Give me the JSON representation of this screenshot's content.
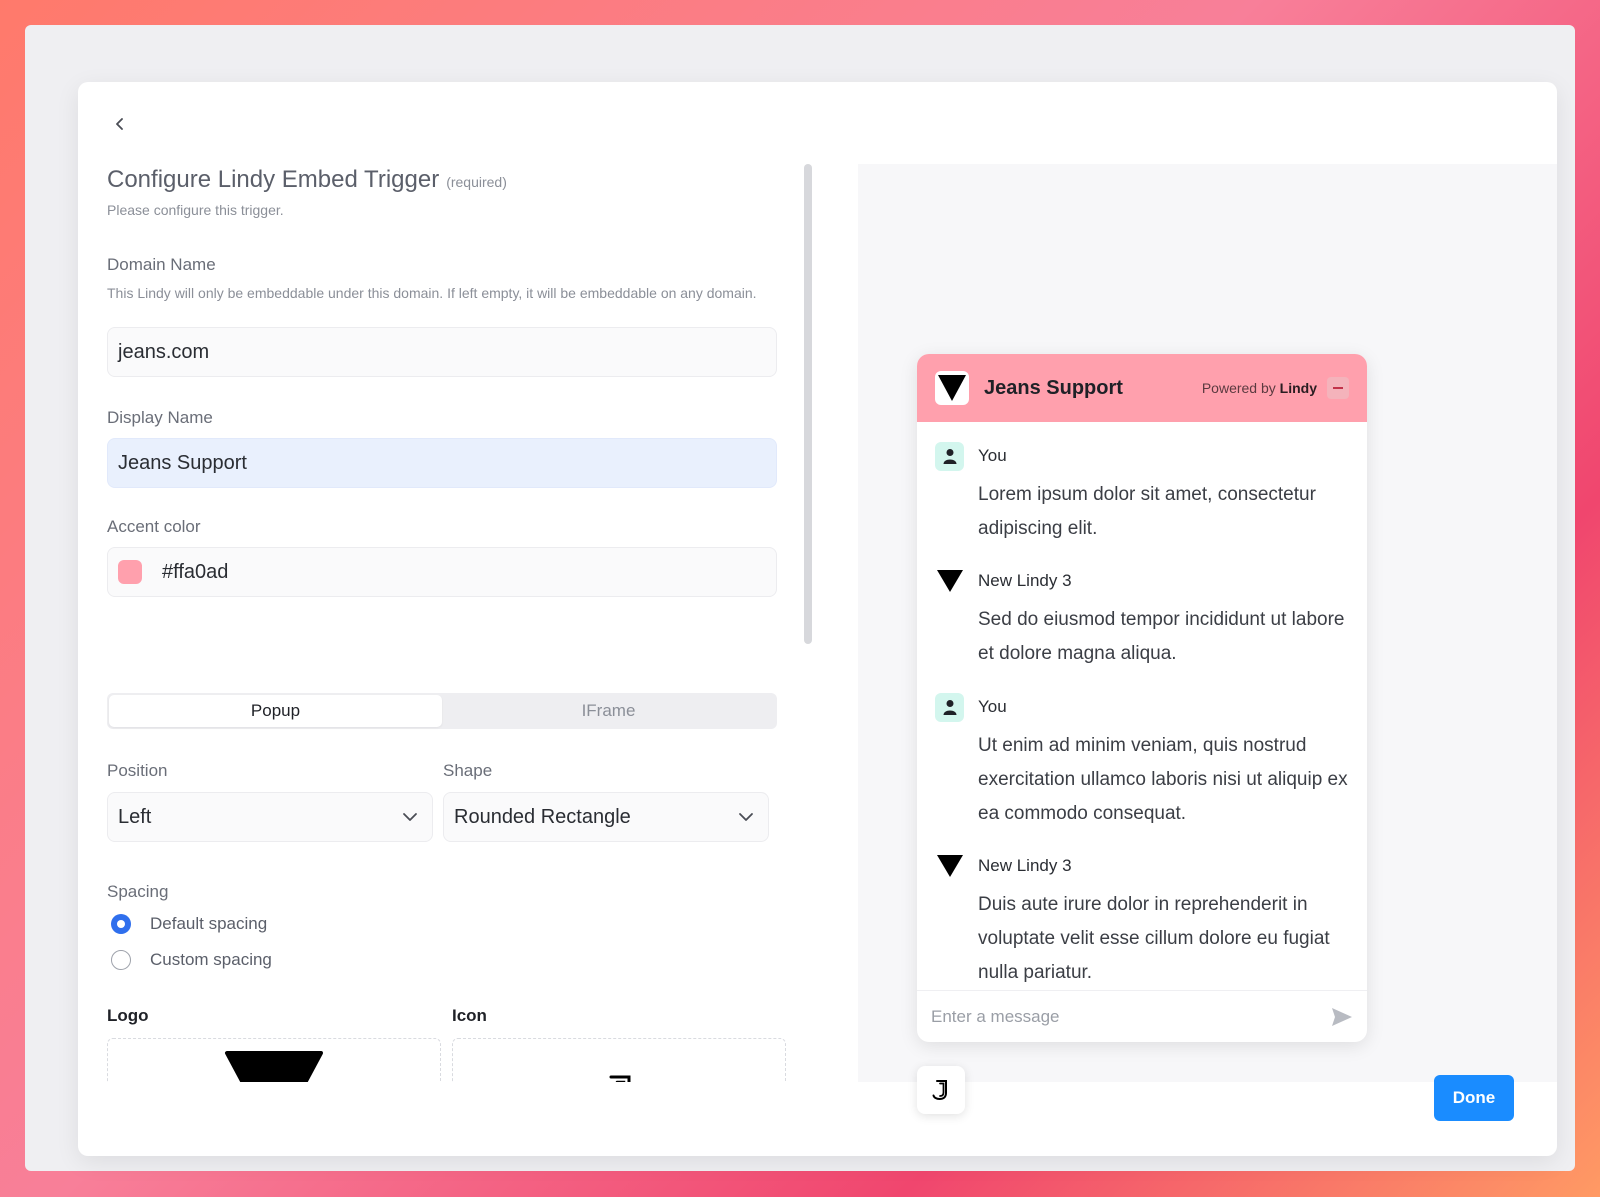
{
  "header": {
    "title": "Configure Lindy Embed Trigger",
    "required_tag": "(required)",
    "subtitle": "Please configure this trigger."
  },
  "form": {
    "domain": {
      "label": "Domain Name",
      "help": "This Lindy will only be embeddable under this domain. If left empty, it will be embeddable on any domain.",
      "value": "jeans.com"
    },
    "display_name": {
      "label": "Display Name",
      "value": "Jeans Support"
    },
    "accent": {
      "label": "Accent color",
      "value": "#ffa0ad"
    },
    "mode_tabs": [
      "Popup",
      "IFrame"
    ],
    "position": {
      "label": "Position",
      "value": "Left"
    },
    "shape": {
      "label": "Shape",
      "value": "Rounded Rectangle"
    },
    "spacing": {
      "label": "Spacing",
      "options": [
        "Default spacing",
        "Custom spacing"
      ],
      "selected": "Default spacing"
    },
    "logo_label": "Logo",
    "icon_label": "Icon"
  },
  "preview": {
    "title": "Jeans Support",
    "powered_prefix": "Powered by",
    "powered_brand": "Lindy",
    "messages": [
      {
        "sender": "You",
        "text": "Lorem ipsum dolor sit amet, consectetur adipiscing elit."
      },
      {
        "sender": "New Lindy 3",
        "text": "Sed do eiusmod tempor incididunt ut labore et dolore magna aliqua."
      },
      {
        "sender": "You",
        "text": "Ut enim ad minim veniam, quis nostrud exercitation ullamco laboris nisi ut aliquip ex ea commodo consequat."
      },
      {
        "sender": "New Lindy 3",
        "text": "Duis aute irure dolor in reprehenderit in voluptate velit esse cillum dolore eu fugiat nulla pariatur."
      }
    ],
    "input_placeholder": "Enter a message"
  },
  "footer": {
    "done_label": "Done"
  },
  "colors": {
    "accent": "#ffa0ad",
    "primary_button": "#1a8cff"
  }
}
